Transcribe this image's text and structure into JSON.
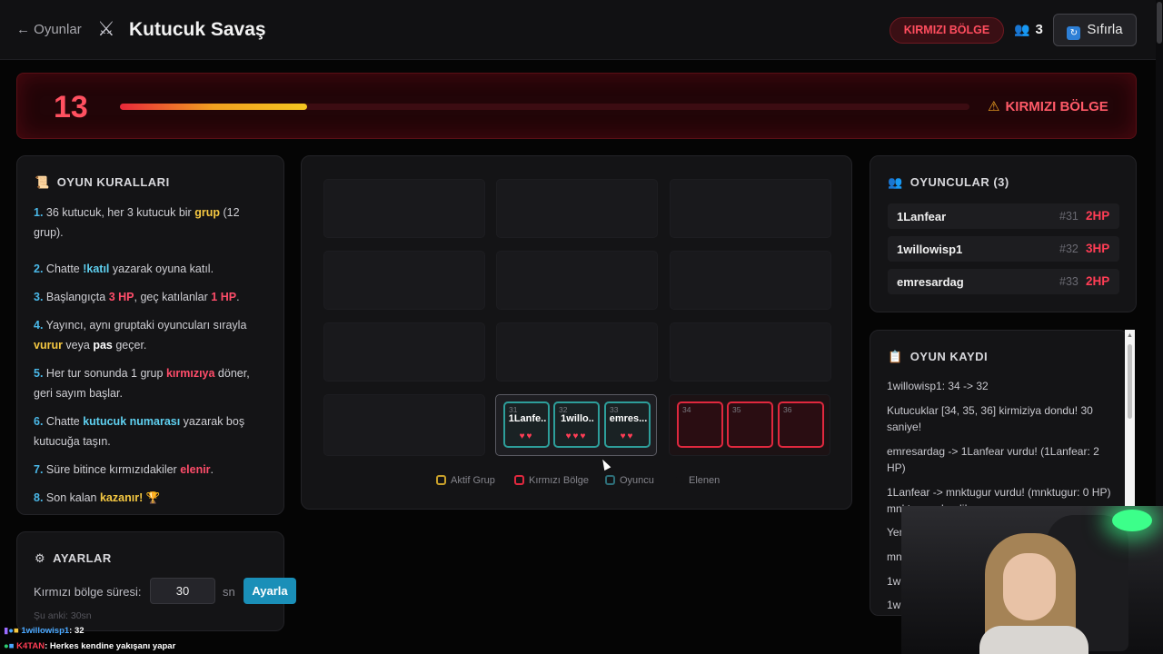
{
  "header": {
    "back_label": "← Oyunlar",
    "game_icon": "crossed-swords-icon",
    "title": "Kutucuk Savaş",
    "zone_badge": "KIRMIZI BÖLGE",
    "player_count": "3",
    "reset_label": "Sıfırla"
  },
  "timer": {
    "seconds": "13",
    "progress": 0.22,
    "warning": "KIRMIZI BÖLGE",
    "colors": {
      "bar_start": "#e8283a",
      "bar_end": "#f5c520"
    }
  },
  "rules": {
    "title": "OYUN KURALLARI",
    "items": [
      {
        "n": "1.",
        "parts": [
          {
            "t": " 36 kutucuk, her 3 kutucuk bir "
          },
          {
            "t": "grup",
            "s": "y"
          },
          {
            "t": " (12 grup)."
          }
        ]
      },
      {
        "n": "2.",
        "parts": [
          {
            "t": " Chatte "
          },
          {
            "t": "!katıl",
            "s": "c"
          },
          {
            "t": " yazarak oyuna katıl."
          }
        ]
      },
      {
        "n": "3.",
        "parts": [
          {
            "t": " Başlangıçta "
          },
          {
            "t": "3 HP",
            "s": "r"
          },
          {
            "t": ", geç katılanlar "
          },
          {
            "t": "1 HP",
            "s": "r"
          },
          {
            "t": "."
          }
        ]
      },
      {
        "n": "4.",
        "parts": [
          {
            "t": " Yayıncı, aynı gruptaki oyuncuları sırayla "
          },
          {
            "t": "vurur",
            "s": "y"
          },
          {
            "t": " veya "
          },
          {
            "t": "pas",
            "s": "w"
          },
          {
            "t": " geçer."
          }
        ]
      },
      {
        "n": "5.",
        "parts": [
          {
            "t": " Her tur sonunda 1 grup "
          },
          {
            "t": "kırmızıya",
            "s": "r"
          },
          {
            "t": " döner, geri sayım başlar."
          }
        ]
      },
      {
        "n": "6.",
        "parts": [
          {
            "t": " Chatte "
          },
          {
            "t": "kutucuk numarası",
            "s": "c"
          },
          {
            "t": " yazarak boş kutucuğa taşın."
          }
        ]
      },
      {
        "n": "7.",
        "parts": [
          {
            "t": " Süre bitince kırmızıdakiler "
          },
          {
            "t": "elenir",
            "s": "r"
          },
          {
            "t": "."
          }
        ]
      },
      {
        "n": "8.",
        "parts": [
          {
            "t": " Son kalan "
          },
          {
            "t": "kazanır!",
            "s": "y"
          },
          {
            "t": " 🏆"
          }
        ]
      }
    ]
  },
  "settings": {
    "title": "AYARLAR",
    "label": "Kırmızı bölge süresi:",
    "value": "30",
    "unit": "sn",
    "button": "Ayarla",
    "current": "Şu anki: 30sn"
  },
  "board": {
    "active_group": {
      "cells": [
        {
          "num": "31",
          "name": "1Lanfe..",
          "hp": 2
        },
        {
          "num": "32",
          "name": "1willo..",
          "hp": 3
        },
        {
          "num": "33",
          "name": "emres...",
          "hp": 2
        }
      ]
    },
    "red_group": {
      "cells": [
        {
          "num": "34"
        },
        {
          "num": "35"
        },
        {
          "num": "36"
        }
      ]
    },
    "legend": [
      "Aktif Grup",
      "Kırmızı Bölge",
      "Oyuncu",
      "Elenen"
    ],
    "colors": {
      "active": "#c8a02a",
      "red": "#e0283e",
      "player": "#2d9e9a"
    }
  },
  "players": {
    "title": "OYUNCULAR (3)",
    "list": [
      {
        "name": "1Lanfear",
        "slot": "#31",
        "hp": "2HP"
      },
      {
        "name": "1willowisp1",
        "slot": "#32",
        "hp": "3HP"
      },
      {
        "name": "emresardag",
        "slot": "#33",
        "hp": "2HP"
      }
    ]
  },
  "log": {
    "title": "OYUN KAYDI",
    "entries": [
      "1willowisp1: 34 -> 32",
      "Kutucuklar [34, 35, 36] kirmiziya dondu! 30 saniye!",
      "emresardag -> 1Lanfear vurdu! (1Lanfear: 2 HP)",
      "1Lanfear -> mnktugur vurdu! (mnktugur: 0 HP) mnktugur elendi!",
      "Yen",
      "mn",
      "1w",
      "1w"
    ]
  },
  "chat": [
    {
      "user": "1willowisp1",
      "msg": ": 32",
      "color": "#4aa8ff"
    },
    {
      "user": "K4TAN",
      "msg": ": Herkes kendine yakışanı yapar",
      "color": "#ff3d55"
    }
  ]
}
